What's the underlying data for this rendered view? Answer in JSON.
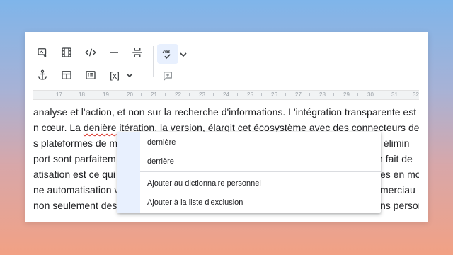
{
  "toolbar": {
    "row1": [
      {
        "icon": "link-image-icon"
      },
      {
        "icon": "film-icon"
      },
      {
        "icon": "code-icon"
      },
      {
        "icon": "horizontal-rule-icon"
      },
      {
        "icon": "page-break-icon"
      }
    ],
    "row2": [
      {
        "icon": "anchor-icon"
      },
      {
        "icon": "table-icon"
      },
      {
        "icon": "list-block-icon"
      },
      {
        "icon": "variable-icon",
        "label": "[x]"
      }
    ],
    "spellcheck": {
      "label": "AB",
      "icon": "spellcheck-icon"
    },
    "comment": {
      "icon": "add-comment-icon"
    }
  },
  "ruler": {
    "labels": [
      "17",
      "18",
      "19",
      "20",
      "21",
      "22",
      "23",
      "24",
      "25",
      "26",
      "27",
      "28",
      "29",
      "30",
      "31",
      "32"
    ]
  },
  "document": {
    "lines": [
      "analyse et l'action, et non sur la recherche d'informations. L'intégration transparente est",
      "n cœur. La ",
      "s plateformes de m",
      "port sont parfaitem",
      "atisation est ce qui t",
      "ne automatisation v",
      "non seulement des"
    ],
    "line2_misspelled": "denière",
    "line2_rest": " itération, la version, élargit cet écosystème avec des connecteurs de s",
    "right_fragments": [
      "la élimin",
      "n fait de",
      "es en mo",
      "merciau",
      "ns persor"
    ]
  },
  "spell_menu": {
    "suggestions": [
      "dernière",
      "derrière"
    ],
    "actions": [
      "Ajouter au dictionnaire personnel",
      "Ajouter à la liste d'exclusion"
    ]
  }
}
